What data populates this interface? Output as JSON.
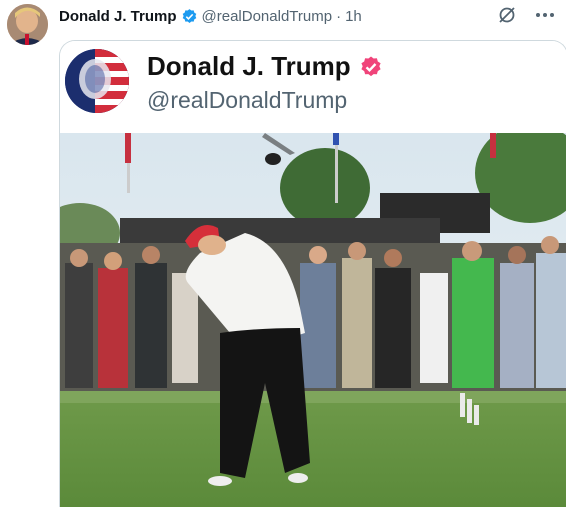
{
  "tweet": {
    "author_name": "Donald J. Trump",
    "handle": "@realDonaldTrump",
    "separator": "·",
    "time": "1h",
    "avatar_icon": "profile-photo",
    "verified_icon": "verified-badge-icon",
    "more_icon": "more-icon",
    "grok_icon": "grok-icon"
  },
  "media": {
    "inner_name": "Donald J. Trump",
    "inner_handle": "@realDonaldTrump",
    "inner_badge_color": "#f0447a",
    "scene": "golf-swing-video-frame"
  },
  "colors": {
    "verified_blue": "#1d9bf0",
    "muted": "#536471",
    "border": "#cfd9de"
  }
}
